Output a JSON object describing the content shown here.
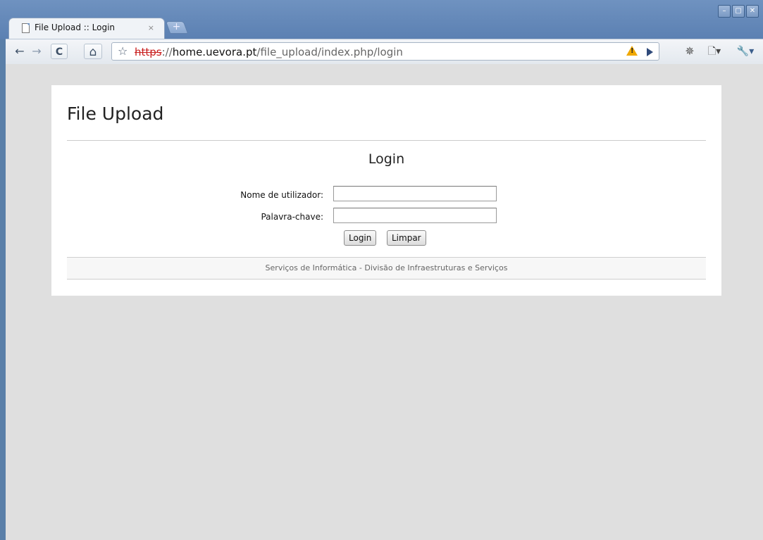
{
  "window": {
    "minimize_glyph": "–",
    "maximize_glyph": "▢",
    "close_glyph": "✕"
  },
  "tab": {
    "title": "File Upload :: Login",
    "close_glyph": "×",
    "new_tab_glyph": "+"
  },
  "toolbar": {
    "back_glyph": "←",
    "forward_glyph": "→",
    "reload_glyph": "C",
    "home_glyph": "⌂",
    "star_glyph": "☆",
    "url_scheme": "https",
    "url_sep": "://",
    "url_host": "home.uevora.pt",
    "url_path": "/file_upload/index.php/login",
    "page_menu_glyph": "🗋▾",
    "wrench_glyph": "🔧▾",
    "extension_glyph": "✵"
  },
  "page": {
    "title": "File Upload",
    "login_heading": "Login",
    "username_label": "Nome de utilizador:",
    "username_value": "",
    "password_label": "Palavra-chave:",
    "password_value": "",
    "login_button": "Login",
    "clear_button": "Limpar",
    "footer": "Serviços de Informática - Divisão de Infraestruturas e Serviços"
  },
  "colors": {
    "frame": "#5b80b2",
    "viewport_bg": "#dfdfdf",
    "url_scheme_strike": "#c81c1c",
    "warning": "#f0a800"
  }
}
